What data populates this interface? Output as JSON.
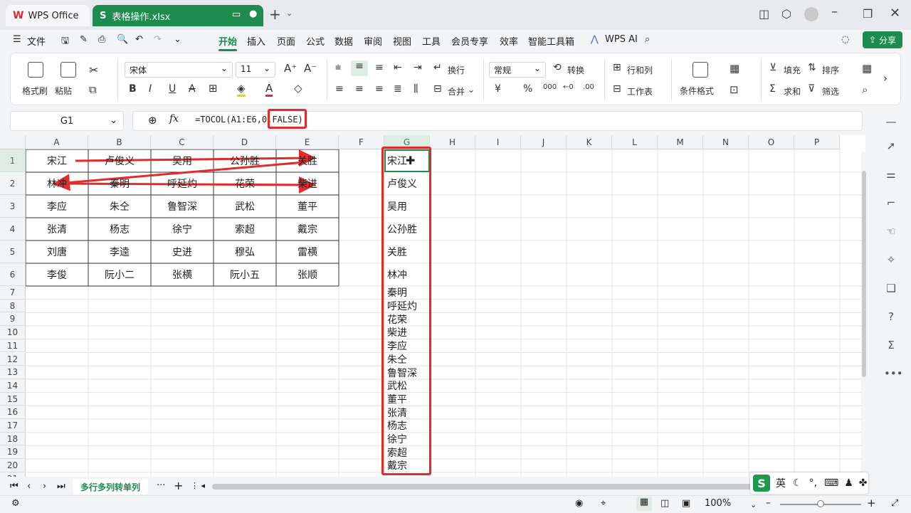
{
  "titlebar": {
    "tabs": [
      {
        "label": "WPS Office"
      },
      {
        "label": "表格操作.xlsx"
      }
    ],
    "new_tab": "+"
  },
  "menubar": {
    "file": "文件",
    "items": [
      "开始",
      "插入",
      "页面",
      "公式",
      "数据",
      "审阅",
      "视图",
      "工具",
      "会员专享",
      "效率",
      "智能工具箱"
    ],
    "active": "开始",
    "wps_ai": "WPS AI",
    "share": "分享"
  },
  "ribbon": {
    "format_painter": "格式刷",
    "paste": "粘贴",
    "font_name": "宋体",
    "font_size": "11",
    "wrap": "换行",
    "merge": "合并",
    "number_format": "常规",
    "convert": "转换",
    "row_col": "行和列",
    "worksheet": "工作表",
    "cond_format": "条件格式",
    "fill": "填充",
    "sort": "排序",
    "sum": "求和",
    "filter": "筛选",
    "bold": "B",
    "italic": "I",
    "underline": "U",
    "strike": "A",
    "currency": "¥",
    "percent": "%",
    "thousand": "000",
    "dec_inc": "←0",
    "dec_dec": ".00"
  },
  "formula": {
    "cell_ref": "G1",
    "fx": "fx",
    "text": "=TOCOL(A1:E6,0,FALSE)"
  },
  "grid": {
    "columns": [
      "A",
      "B",
      "C",
      "D",
      "E",
      "F",
      "G",
      "H",
      "I",
      "J",
      "K",
      "L",
      "M",
      "N",
      "O",
      "P"
    ],
    "rows": [
      "1",
      "2",
      "3",
      "4",
      "5",
      "6",
      "7",
      "8",
      "9",
      "10",
      "11",
      "12",
      "13",
      "14",
      "15",
      "16",
      "17",
      "18",
      "19",
      "20",
      "21"
    ],
    "table": [
      [
        "宋江",
        "卢俊义",
        "吴用",
        "公孙胜",
        "关胜"
      ],
      [
        "林冲",
        "秦明",
        "呼延灼",
        "花荣",
        "柴进"
      ],
      [
        "李应",
        "朱仝",
        "鲁智深",
        "武松",
        "董平"
      ],
      [
        "张清",
        "杨志",
        "徐宁",
        "索超",
        "戴宗"
      ],
      [
        "刘唐",
        "李逵",
        "史进",
        "穆弘",
        "雷横"
      ],
      [
        "李俊",
        "阮小二",
        "张横",
        "阮小五",
        "张顺"
      ]
    ],
    "col_g": [
      "宋江",
      "卢俊义",
      "吴用",
      "公孙胜",
      "关胜",
      "林冲",
      "秦明",
      "呼延灼",
      "花荣",
      "柴进",
      "李应",
      "朱仝",
      "鲁智深",
      "武松",
      "董平",
      "张清",
      "杨志",
      "徐宁",
      "索超",
      "戴宗"
    ]
  },
  "sheets": {
    "active": "多行多列转单列"
  },
  "status": {
    "zoom": "100%"
  },
  "ime": {
    "logo": "S",
    "lang": "英"
  },
  "colors": {
    "accent": "#1e8c4f",
    "annotation": "#e42a2a"
  }
}
